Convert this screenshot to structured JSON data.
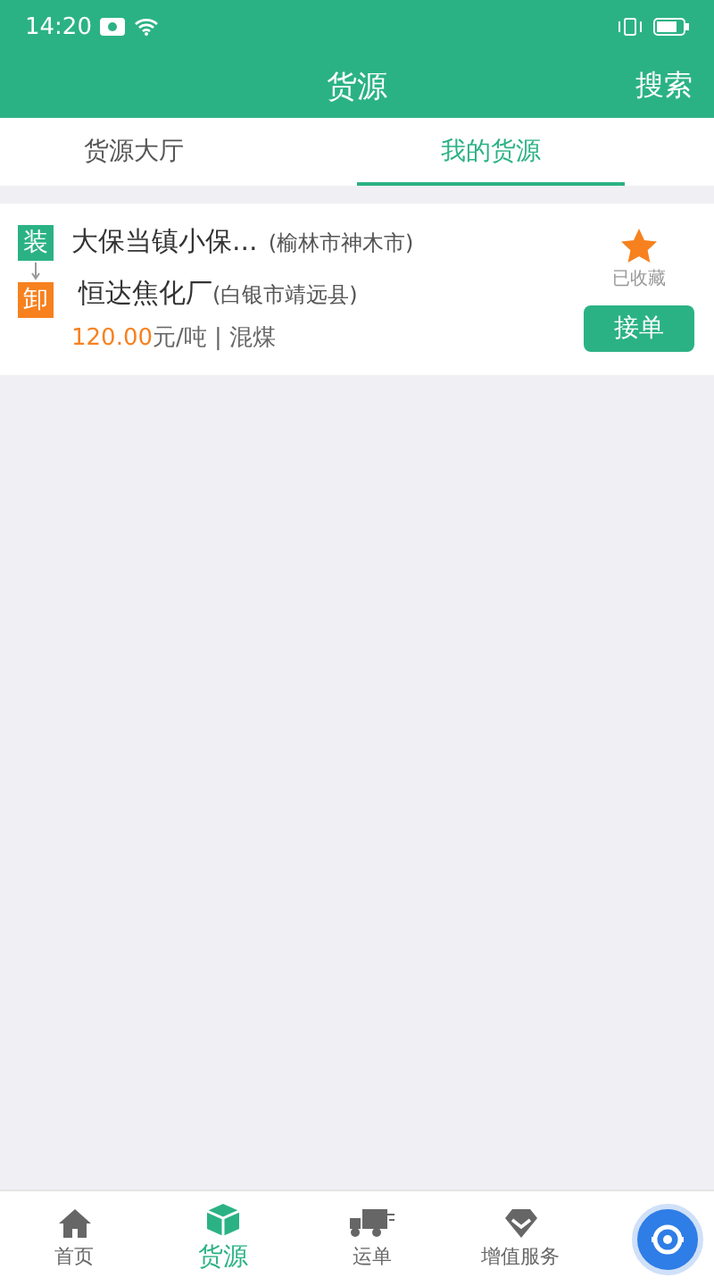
{
  "status_bar": {
    "time": "14:20"
  },
  "header": {
    "title": "货源",
    "action": "搜索"
  },
  "tabs": [
    {
      "label": "货源大厅",
      "selected": false
    },
    {
      "label": "我的货源",
      "selected": true
    }
  ],
  "cargo_list": [
    {
      "load_tag": "装",
      "unload_tag": "卸",
      "origin": "大保当镇小保...",
      "origin_area": "(榆林市神木市)",
      "destination": "恒达焦化厂",
      "destination_area": "(白银市靖远县)",
      "price": "120.00",
      "unit": "元/吨 | 混煤",
      "favorited": true,
      "favorite_label": "已收藏",
      "accept_button": "接单"
    }
  ],
  "bottom_nav": [
    {
      "kind": "home",
      "label": "首页",
      "selected": false
    },
    {
      "kind": "cargo",
      "label": "货源",
      "selected": true
    },
    {
      "kind": "truck",
      "label": "运单",
      "selected": false
    },
    {
      "kind": "diamond",
      "label": "增值服务",
      "selected": false
    }
  ]
}
